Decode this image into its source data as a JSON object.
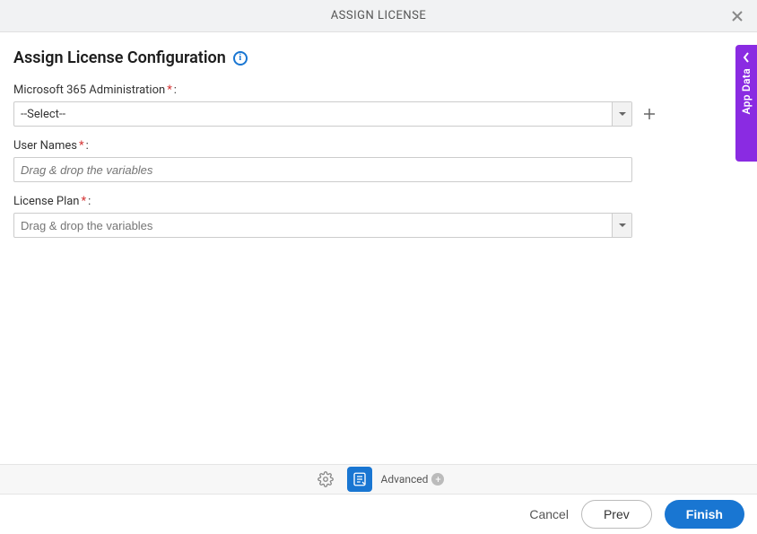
{
  "header": {
    "title": "ASSIGN LICENSE"
  },
  "page": {
    "title": "Assign License Configuration"
  },
  "fields": {
    "ms365": {
      "label": "Microsoft 365 Administration",
      "value": "--Select--"
    },
    "usernames": {
      "label": "User Names",
      "placeholder": "Drag & drop the variables"
    },
    "licenseplan": {
      "label": "License Plan",
      "placeholder": "Drag & drop the variables"
    }
  },
  "sideTab": {
    "label": "App Data"
  },
  "bottomBar": {
    "advanced": "Advanced"
  },
  "footer": {
    "cancel": "Cancel",
    "prev": "Prev",
    "finish": "Finish"
  }
}
